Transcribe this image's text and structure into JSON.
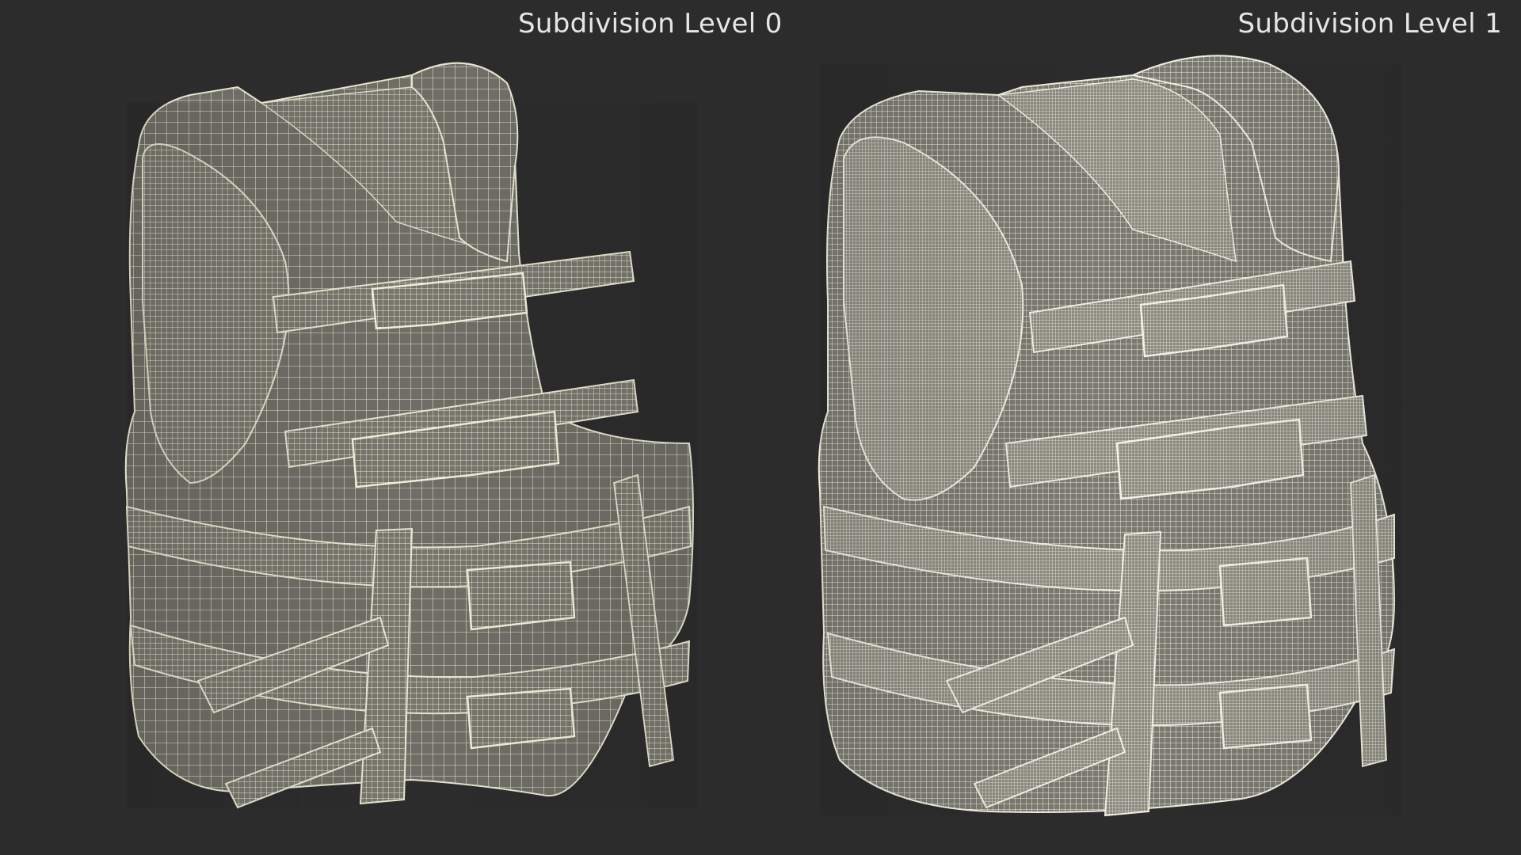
{
  "scene": {
    "background_color": "#2c2c2c",
    "wire_color_level0": "#e9e6d2",
    "wire_color_level1": "#f1eee0",
    "shade_color": "#6b6b63"
  },
  "labels": {
    "left": "Subdivision Level 0",
    "right": "Subdivision Level 1"
  },
  "views": [
    {
      "name": "Subdivision Level 0",
      "grid_density": "coarse"
    },
    {
      "name": "Subdivision Level 1",
      "grid_density": "fine"
    }
  ]
}
